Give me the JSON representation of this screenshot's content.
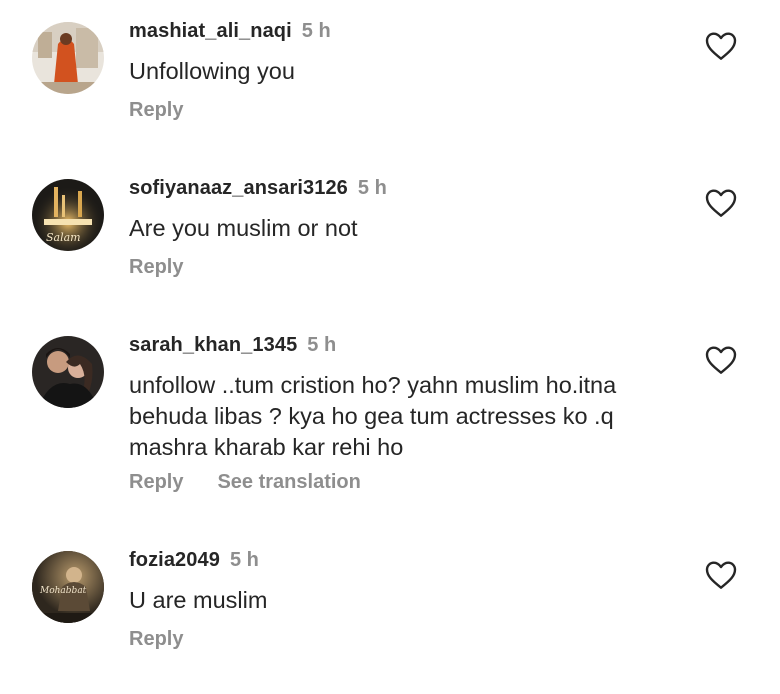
{
  "comments": [
    {
      "username": "mashiat_ali_naqi",
      "time": "5 h",
      "text": "Unfollowing you",
      "reply_label": "Reply",
      "avatar": "woman-in-orange-avatar",
      "liked": false
    },
    {
      "username": "sofiyanaaz_ansari3126",
      "time": "5 h",
      "text": "Are you muslim or not",
      "reply_label": "Reply",
      "avatar": "candlelight-avatar",
      "liked": false
    },
    {
      "username": "sarah_khan_1345",
      "time": "5 h",
      "text": "unfollow ..tum cristion ho? yahn muslim ho.itna behuda libas ? kya ho gea tum actresses  ko .q mashra kharab kar rehi ho",
      "reply_label": "Reply",
      "translation_label": "See translation",
      "avatar": "couple-avatar",
      "liked": false
    },
    {
      "username": "fozia2049",
      "time": "5 h",
      "text": "U are muslim",
      "reply_label": "Reply",
      "avatar": "vintage-photo-avatar",
      "liked": false
    }
  ],
  "icons": {
    "like": "heart-outline-icon"
  },
  "colors": {
    "text": "#262626",
    "secondary": "#8e8e8e",
    "background": "#ffffff"
  }
}
